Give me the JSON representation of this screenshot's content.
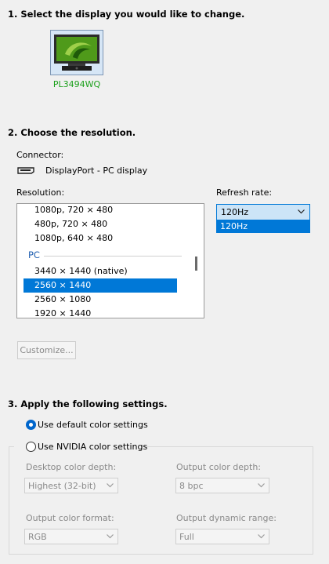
{
  "section1": {
    "title": "1. Select the display you would like to change."
  },
  "display": {
    "label": "PL3494WQ",
    "icon": "nvidia-monitor-icon"
  },
  "section2": {
    "title": "2. Choose the resolution.",
    "connector_label": "Connector:",
    "connector_value": "DisplayPort - PC display",
    "resolution_label": "Resolution:",
    "refresh_label": "Refresh rate:",
    "resolutions_top": [
      "1080p, 720 × 480",
      "480p, 720 × 480",
      "1080p, 640 × 480"
    ],
    "group_pc": "PC",
    "resolutions_pc": [
      "3440 × 1440 (native)",
      "2560 × 1440",
      "2560 × 1080",
      "1920 × 1440"
    ],
    "selected_resolution": "2560 × 1440",
    "refresh_value": "120Hz",
    "refresh_option": "120Hz",
    "customize_label": "Customize..."
  },
  "section3": {
    "title": "3. Apply the following settings.",
    "radio_default": "Use default color settings",
    "radio_nvidia": "Use NVIDIA color settings",
    "desktop_depth_label": "Desktop color depth:",
    "desktop_depth_value": "Highest (32-bit)",
    "output_depth_label": "Output color depth:",
    "output_depth_value": "8 bpc",
    "output_format_label": "Output color format:",
    "output_format_value": "RGB",
    "dynamic_range_label": "Output dynamic range:",
    "dynamic_range_value": "Full"
  },
  "colors": {
    "accent": "#0078d7",
    "display_label": "#1ca01c",
    "group_header": "#1f5fb0"
  }
}
